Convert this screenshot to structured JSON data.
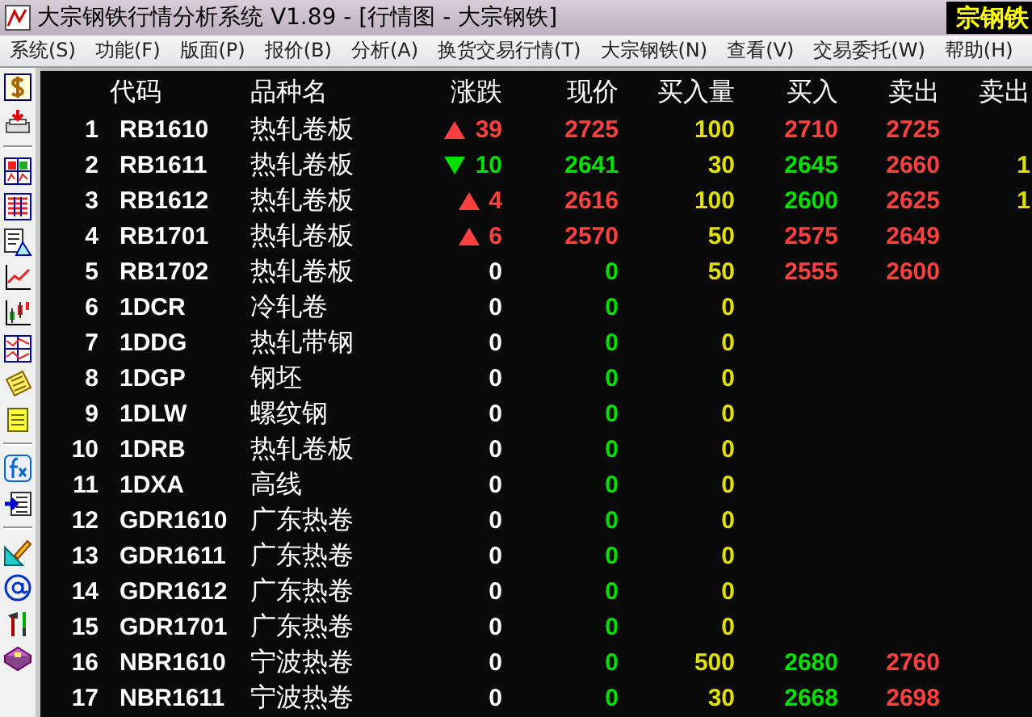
{
  "window": {
    "title": "大宗钢铁行情分析系统 V1.89 - [行情图 - 大宗钢铁]",
    "badge": "宗钢铁"
  },
  "menu": [
    "系统(S)",
    "功能(F)",
    "版面(P)",
    "报价(B)",
    "分析(A)",
    "换货交易行情(T)",
    "大宗钢铁(N)",
    "查看(V)",
    "交易委托(W)",
    "帮助(H)"
  ],
  "table": {
    "columns": [
      "代码",
      "品种名",
      "涨跌",
      "现价",
      "买入量",
      "买入",
      "卖出",
      "卖出"
    ],
    "rows": [
      {
        "no": "1",
        "code": "RB1610",
        "name": "热轧卷板",
        "change": {
          "text": "39",
          "kind": "up",
          "color": "#ff4040"
        },
        "price": {
          "text": "2725",
          "color": "#ff4040"
        },
        "volume": "100",
        "bid": {
          "text": "2710",
          "color": "#ff4040"
        },
        "ask": {
          "text": "2725",
          "color": "#ff4040"
        }
      },
      {
        "no": "2",
        "code": "RB1611",
        "name": "热轧卷板",
        "change": {
          "text": "10",
          "kind": "down",
          "color": "#00e000"
        },
        "price": {
          "text": "2641",
          "color": "#00e000"
        },
        "volume": "30",
        "bid": {
          "text": "2645",
          "color": "#00e000"
        },
        "ask": {
          "text": "2660",
          "color": "#ff4040"
        },
        "ask_volume": "1"
      },
      {
        "no": "3",
        "code": "RB1612",
        "name": "热轧卷板",
        "change": {
          "text": "4",
          "kind": "up",
          "color": "#ff4040"
        },
        "price": {
          "text": "2616",
          "color": "#ff4040"
        },
        "volume": "100",
        "bid": {
          "text": "2600",
          "color": "#00e000"
        },
        "ask": {
          "text": "2625",
          "color": "#ff4040"
        },
        "ask_volume": "1"
      },
      {
        "no": "4",
        "code": "RB1701",
        "name": "热轧卷板",
        "change": {
          "text": "6",
          "kind": "up",
          "color": "#ff4040"
        },
        "price": {
          "text": "2570",
          "color": "#ff4040"
        },
        "volume": "50",
        "bid": {
          "text": "2575",
          "color": "#ff4040"
        },
        "ask": {
          "text": "2649",
          "color": "#ff4040"
        }
      },
      {
        "no": "5",
        "code": "RB1702",
        "name": "热轧卷板",
        "change": {
          "text": "0",
          "color": "#ffffff"
        },
        "price": {
          "text": "0",
          "color": "#00e000"
        },
        "volume": "50",
        "bid": {
          "text": "2555",
          "color": "#ff4040"
        },
        "ask": {
          "text": "2600",
          "color": "#ff4040"
        }
      },
      {
        "no": "6",
        "code": "1DCR",
        "name": "冷轧卷",
        "change": {
          "text": "0",
          "color": "#ffffff"
        },
        "price": {
          "text": "0",
          "color": "#00e000"
        },
        "volume": "0"
      },
      {
        "no": "7",
        "code": "1DDG",
        "name": "热轧带钢",
        "change": {
          "text": "0",
          "color": "#ffffff"
        },
        "price": {
          "text": "0",
          "color": "#00e000"
        },
        "volume": "0"
      },
      {
        "no": "8",
        "code": "1DGP",
        "name": "钢坯",
        "change": {
          "text": "0",
          "color": "#ffffff"
        },
        "price": {
          "text": "0",
          "color": "#00e000"
        },
        "volume": "0"
      },
      {
        "no": "9",
        "code": "1DLW",
        "name": "螺纹钢",
        "change": {
          "text": "0",
          "color": "#ffffff"
        },
        "price": {
          "text": "0",
          "color": "#00e000"
        },
        "volume": "0"
      },
      {
        "no": "10",
        "code": "1DRB",
        "name": "热轧卷板",
        "change": {
          "text": "0",
          "color": "#ffffff"
        },
        "price": {
          "text": "0",
          "color": "#00e000"
        },
        "volume": "0"
      },
      {
        "no": "11",
        "code": "1DXA",
        "name": "高线",
        "change": {
          "text": "0",
          "color": "#ffffff"
        },
        "price": {
          "text": "0",
          "color": "#00e000"
        },
        "volume": "0"
      },
      {
        "no": "12",
        "code": "GDR1610",
        "name": "广东热卷",
        "change": {
          "text": "0",
          "color": "#ffffff"
        },
        "price": {
          "text": "0",
          "color": "#00e000"
        },
        "volume": "0"
      },
      {
        "no": "13",
        "code": "GDR1611",
        "name": "广东热卷",
        "change": {
          "text": "0",
          "color": "#ffffff"
        },
        "price": {
          "text": "0",
          "color": "#00e000"
        },
        "volume": "0"
      },
      {
        "no": "14",
        "code": "GDR1612",
        "name": "广东热卷",
        "change": {
          "text": "0",
          "color": "#ffffff"
        },
        "price": {
          "text": "0",
          "color": "#00e000"
        },
        "volume": "0"
      },
      {
        "no": "15",
        "code": "GDR1701",
        "name": "广东热卷",
        "change": {
          "text": "0",
          "color": "#ffffff"
        },
        "price": {
          "text": "0",
          "color": "#00e000"
        },
        "volume": "0"
      },
      {
        "no": "16",
        "code": "NBR1610",
        "name": "宁波热卷",
        "change": {
          "text": "0",
          "color": "#ffffff"
        },
        "price": {
          "text": "0",
          "color": "#00e000"
        },
        "volume": "500",
        "bid": {
          "text": "2680",
          "color": "#00e000"
        },
        "ask": {
          "text": "2760",
          "color": "#ff4040"
        }
      },
      {
        "no": "17",
        "code": "NBR1611",
        "name": "宁波热卷",
        "change": {
          "text": "0",
          "color": "#ffffff"
        },
        "price": {
          "text": "0",
          "color": "#00e000"
        },
        "volume": "30",
        "bid": {
          "text": "2668",
          "color": "#00e000"
        },
        "ask": {
          "text": "2698",
          "color": "#ff4040"
        }
      }
    ]
  }
}
